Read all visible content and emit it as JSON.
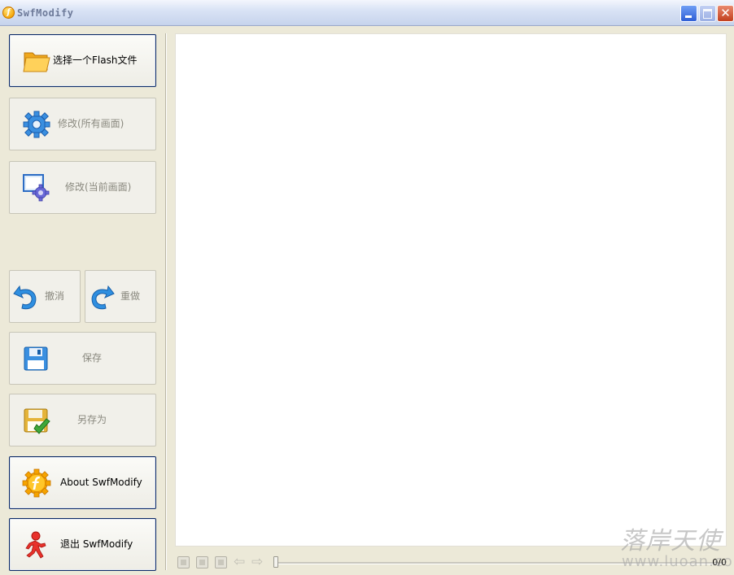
{
  "window": {
    "title": "SwfModify",
    "app_icon_glyph": "f",
    "close_glyph": "✕"
  },
  "sidebar": {
    "select_file": "选择一个Flash文件",
    "modify_all": "修改(所有画面)",
    "modify_current": "修改(当前画面)",
    "undo": "撤消",
    "redo": "重做",
    "save": "保存",
    "save_as": "另存为",
    "about": "About SwfModify",
    "exit": "退出 SwfModify"
  },
  "player": {
    "prev_glyph": "⇦",
    "next_glyph": "⇨",
    "counter": "0/0",
    "progress": 0
  },
  "watermark": {
    "text": "落岸天使",
    "url": "www.luoan.com"
  },
  "colors": {
    "accent": "#0c2a66",
    "disabled_text": "#8a897f",
    "background": "#ece9d8"
  }
}
